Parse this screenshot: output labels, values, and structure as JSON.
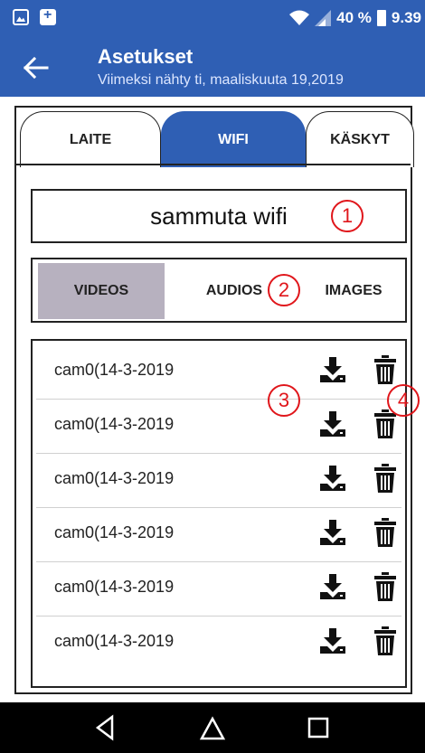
{
  "status_bar": {
    "battery_text": "40 %",
    "time": "9.39",
    "icons": [
      "image-icon",
      "plus-icon",
      "wifi-icon",
      "signal-icon",
      "battery-icon"
    ]
  },
  "app_bar": {
    "title": "Asetukset",
    "subtitle": "Viimeksi nähty ti, maaliskuuta 19,2019",
    "back_icon": "arrow-back-icon"
  },
  "tabs": [
    {
      "label": "LAITE",
      "selected": false
    },
    {
      "label": "WIFI",
      "selected": true
    },
    {
      "label": "KÄSKYT",
      "selected": false
    }
  ],
  "wifi_button": {
    "label": "sammuta wifi"
  },
  "segments": [
    {
      "label": "VIDEOS",
      "selected": true
    },
    {
      "label": "AUDIOS",
      "selected": false
    },
    {
      "label": "IMAGES",
      "selected": false
    }
  ],
  "files": [
    {
      "name": "cam0(14-3-2019"
    },
    {
      "name": "cam0(14-3-2019"
    },
    {
      "name": "cam0(14-3-2019"
    },
    {
      "name": "cam0(14-3-2019"
    },
    {
      "name": "cam0(14-3-2019"
    },
    {
      "name": "cam0(14-3-2019"
    }
  ],
  "annotations": [
    "1",
    "2",
    "3",
    "4"
  ],
  "colors": {
    "primary": "#2f5fb4",
    "selected_segment": "#b7b1bf",
    "annotation": "#e0161b"
  },
  "nav_icons": [
    "nav-back-icon",
    "nav-home-icon",
    "nav-recents-icon"
  ]
}
